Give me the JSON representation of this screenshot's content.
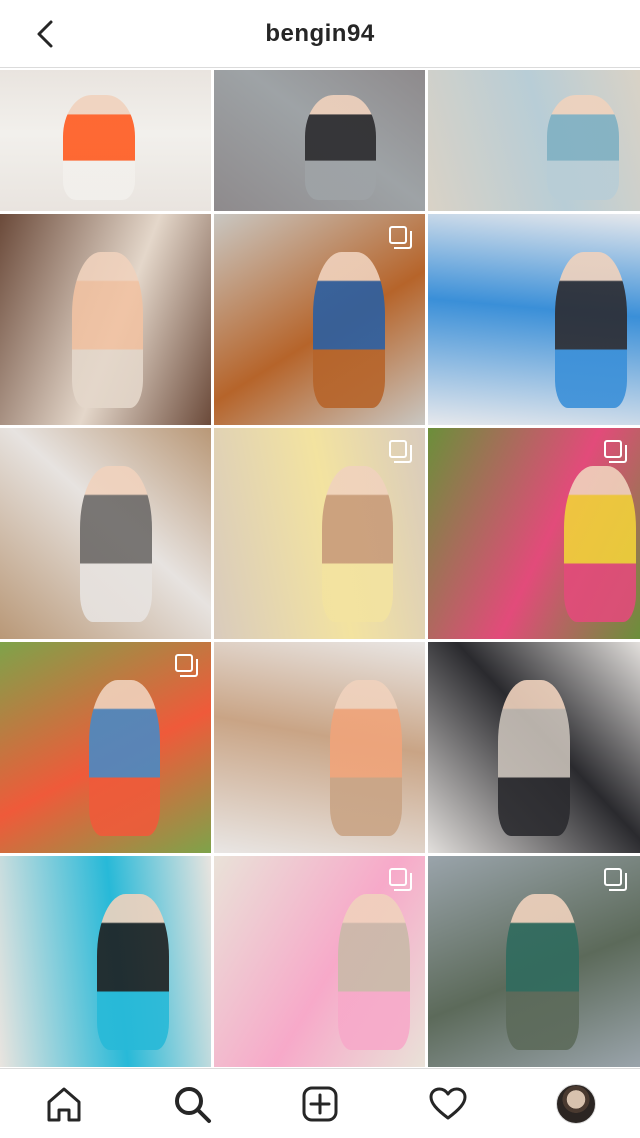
{
  "header": {
    "username": "bengin94",
    "back_icon": "chevron-left-icon"
  },
  "grid": {
    "posts": [
      {
        "name": "post-orange-leggings-mirror",
        "multi": false,
        "colors": [
          "#e9e4df",
          "#f2f0ec",
          "#ff5a1f"
        ]
      },
      {
        "name": "post-workout-band-kick",
        "multi": false,
        "colors": [
          "#8e8a8c",
          "#9ea3a6",
          "#2b2a2d"
        ]
      },
      {
        "name": "post-grey-leggings-mirror",
        "multi": false,
        "colors": [
          "#d9d2c6",
          "#b8cdd6",
          "#7fb0c2"
        ]
      },
      {
        "name": "post-selfie-sweater",
        "multi": false,
        "colors": [
          "#6b4a3a",
          "#e4d7ca",
          "#f1c2a2"
        ]
      },
      {
        "name": "post-bench-park",
        "multi": true,
        "colors": [
          "#c9c7c2",
          "#b6642a",
          "#2b5fa2"
        ]
      },
      {
        "name": "post-gym-flex",
        "multi": false,
        "colors": [
          "#e6e8ec",
          "#3a8fd8",
          "#2c2b30"
        ]
      },
      {
        "name": "post-mom-baby-sofa",
        "multi": false,
        "colors": [
          "#b99877",
          "#e7e3e0",
          "#6d6a68"
        ]
      },
      {
        "name": "post-yellow-bra-mirror",
        "multi": true,
        "colors": [
          "#d9cbbd",
          "#f3e3a0",
          "#c89b7a"
        ]
      },
      {
        "name": "post-flowers-baby",
        "multi": true,
        "colors": [
          "#6b8f3a",
          "#e24b7a",
          "#f1d13a"
        ]
      },
      {
        "name": "post-swing-baby",
        "multi": true,
        "colors": [
          "#7ea34a",
          "#ef5a3a",
          "#4a89c4"
        ]
      },
      {
        "name": "post-baby-eating",
        "multi": false,
        "colors": [
          "#e9e6e4",
          "#c9a485",
          "#f0a47a"
        ]
      },
      {
        "name": "post-before-after",
        "multi": false,
        "colors": [
          "#e2dfdc",
          "#2a2a2e",
          "#c8c0b8"
        ]
      },
      {
        "name": "post-blue-bikini-mirror",
        "multi": false,
        "colors": [
          "#e9e4df",
          "#27b9d8",
          "#1f1f1f"
        ]
      },
      {
        "name": "post-baby-pink-chair",
        "multi": true,
        "colors": [
          "#e9e2d8",
          "#f7a9c9",
          "#c9b9a8"
        ]
      },
      {
        "name": "post-waterfall-landscape",
        "multi": true,
        "colors": [
          "#9aa4ab",
          "#5c6a5a",
          "#2f6b5e"
        ]
      }
    ]
  },
  "nav": {
    "items": [
      {
        "name": "home",
        "icon": "home-icon"
      },
      {
        "name": "search",
        "icon": "search-icon"
      },
      {
        "name": "create",
        "icon": "plus-square-icon"
      },
      {
        "name": "activity",
        "icon": "heart-icon"
      },
      {
        "name": "profile",
        "icon": "avatar"
      }
    ]
  }
}
